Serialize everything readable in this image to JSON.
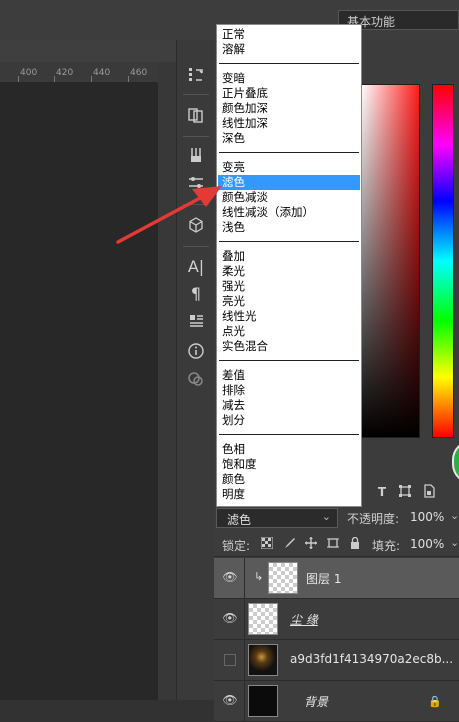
{
  "header": {
    "workspace_label": "基本功能"
  },
  "ruler": {
    "ticks": [
      "400",
      "420",
      "440",
      "460"
    ]
  },
  "blend_menu": {
    "groups": [
      [
        "正常",
        "溶解"
      ],
      [
        "变暗",
        "正片叠底",
        "颜色加深",
        "线性加深",
        "深色"
      ],
      [
        "变亮",
        "滤色",
        "颜色减淡",
        "线性减淡（添加）",
        "浅色"
      ],
      [
        "叠加",
        "柔光",
        "强光",
        "亮光",
        "线性光",
        "点光",
        "实色混合"
      ],
      [
        "差值",
        "排除",
        "减去",
        "划分"
      ],
      [
        "色相",
        "饱和度",
        "颜色",
        "明度"
      ]
    ],
    "selected": "滤色"
  },
  "layers_panel": {
    "blend_mode": "滤色",
    "opacity_label": "不透明度:",
    "opacity_value": "100%",
    "lock_label": "锁定:",
    "fill_label": "填充:",
    "fill_value": "100%",
    "layers": [
      {
        "name": "图层 1",
        "visible": true,
        "active": true,
        "clipped": true,
        "thumb": "transparent"
      },
      {
        "name": "尘 缘",
        "visible": true,
        "active": false,
        "thumb": "transparent"
      },
      {
        "name": "a9d3fd1f4134970a2ec8b...",
        "visible": false,
        "active": false,
        "thumb": "image"
      },
      {
        "name": "背景",
        "visible": true,
        "active": false,
        "thumb": "dark",
        "locked": true
      }
    ]
  },
  "colors": {
    "selection": "#3399ff",
    "panel_bg": "#3c3c3c",
    "active_layer": "#5a5a5a",
    "arrow": "#e53935"
  },
  "icons": {
    "toolbar": [
      "history-icon",
      "clone-source-icon",
      "brush-icon",
      "brush-settings-icon",
      "3d-icon",
      "character-icon",
      "paragraph-icon",
      "properties-icon",
      "info-icon",
      "color-sampler-icon"
    ],
    "layer_filters": [
      "type-filter-icon",
      "transform-filter-icon",
      "smart-object-filter-icon"
    ],
    "locks": [
      "lock-pixels-icon",
      "lock-image-icon",
      "lock-position-icon",
      "lock-artboard-icon",
      "lock-all-icon"
    ]
  }
}
